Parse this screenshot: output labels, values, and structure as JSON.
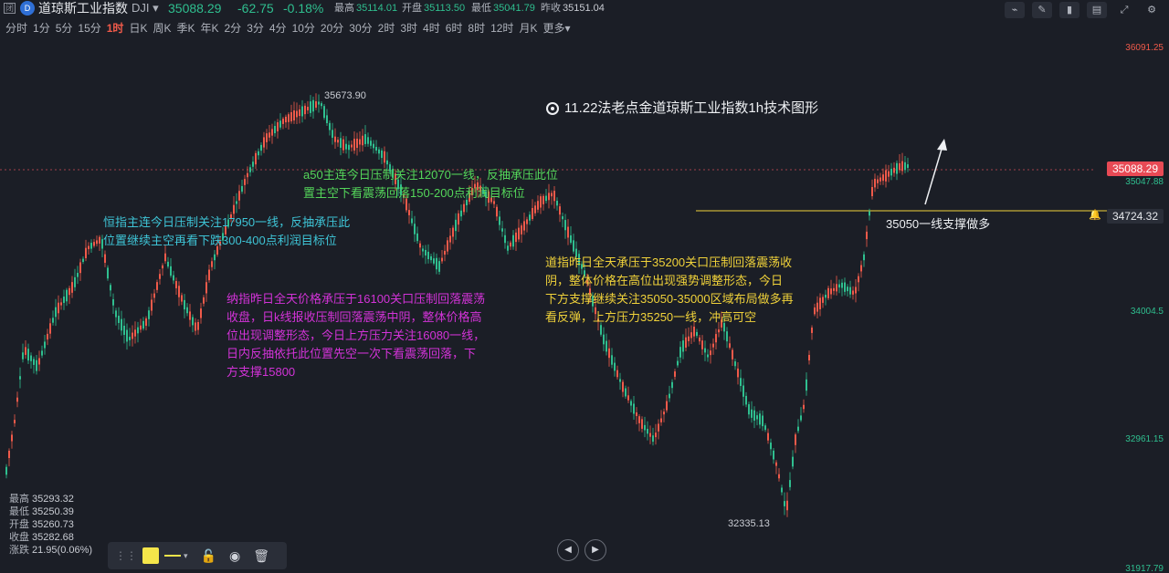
{
  "header": {
    "close_label": "闭",
    "logo_text": "D",
    "title": "道琼斯工业指数",
    "code": "DJI ▾",
    "price": "35088.29",
    "change": "-62.75",
    "change_pct": "-0.18%",
    "stats": [
      {
        "label": "最高",
        "value": "35114.01"
      },
      {
        "label": "开盘",
        "value": "35113.50"
      },
      {
        "label": "最低",
        "value": "35041.79"
      },
      {
        "label": "昨收",
        "value": "35151.04"
      }
    ]
  },
  "toolbar_icons": [
    "chart-line-icon",
    "edit-icon",
    "candle-icon",
    "layout-icon",
    "expand-icon",
    "settings-icon"
  ],
  "periods": [
    "分时",
    "1分",
    "5分",
    "15分",
    "1时",
    "日K",
    "周K",
    "季K",
    "年K",
    "2分",
    "3分",
    "4分",
    "10分",
    "20分",
    "30分",
    "2时",
    "3时",
    "4时",
    "6时",
    "8时",
    "12时",
    "月K",
    "更多▾"
  ],
  "active_period": "1时",
  "notes": {
    "title": "11.22法老点金道琼斯工业指数1h技术图形",
    "cyan": "恒指主连今日压制关注17950一线，反抽承压此位置继续主空再看下跌300-400点利润目标位",
    "green": "a50主连今日压制关注12070一线，反抽承压此位置主空下看震荡回落150-200点利润目标位",
    "magenta": "纳指昨日全天价格承压于16100关口压制回落震荡收盘，日k线报收压制回落震荡中阴，整体价格高位出现调整形态，今日上方压力关注16080一线，日内反抽依托此位置先空一次下看震荡回落，下方支撑15800",
    "yellow": "道指昨日全天承压于35200关口压制回落震荡收阴，整体价格在高位出现强势调整形态，今日下方支撑继续关注35050-35000区域布局做多再看反弹，上方压力35250一线，冲高可空",
    "support": "35050一线支撑做多"
  },
  "chart_data": {
    "type": "candlestick",
    "high_marker": "35673.90",
    "low_marker": "32335.13",
    "y_ticks": [
      "36091.25",
      "35047.88",
      "34004.5",
      "32961.15",
      "31917.79"
    ],
    "current_price": "35088.29",
    "line_price": "34724.32",
    "colors": {
      "up": "#f05a4a",
      "down": "#2fbf8f",
      "accent": "#f0d23a"
    }
  },
  "bottom_stats": [
    {
      "label": "最高",
      "value": "35293.32"
    },
    {
      "label": "最低",
      "value": "35250.39"
    },
    {
      "label": "开盘",
      "value": "35260.73"
    },
    {
      "label": "收盘",
      "value": "35282.68"
    },
    {
      "label": "涨跌",
      "value": "21.95(0.06%)"
    }
  ]
}
